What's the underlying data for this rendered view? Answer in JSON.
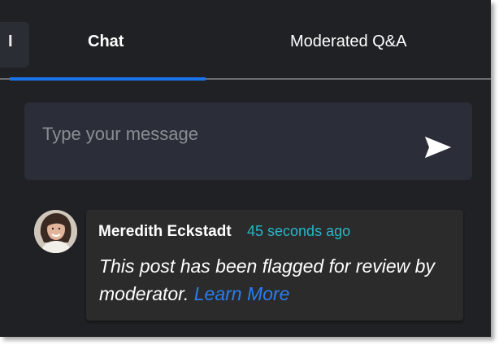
{
  "tabs": {
    "partial_tab_glyph": "I",
    "chat_label": "Chat",
    "qa_label": "Moderated Q&A",
    "active_tab": "Chat"
  },
  "composer": {
    "placeholder": "Type your message",
    "value": "",
    "send_icon": "send-icon"
  },
  "messages": [
    {
      "author": "Meredith Eckstadt",
      "time": "45 seconds ago",
      "text": "This post has been flagged for review by moderator.",
      "link_text": "Learn More"
    }
  ],
  "colors": {
    "background": "#202124",
    "tab_indicator": "#1a73e8",
    "timestamp": "#29b6c6",
    "link": "#2a7df0",
    "composer_bg": "#2b2e38",
    "bubble_bg": "#2b2b2b"
  }
}
